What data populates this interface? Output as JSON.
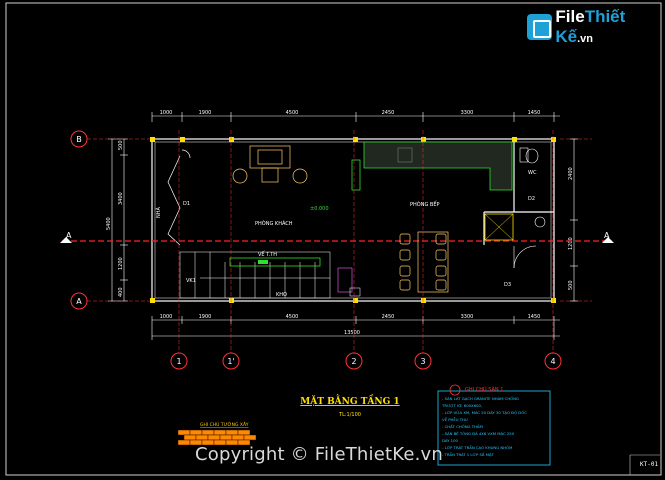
{
  "logo": {
    "brand_left": "File",
    "brand_right": "Thiết Kế",
    "suffix": ".vn"
  },
  "watermark": "Copyright © FileThietKe.vn",
  "sheet_no": "KT-01",
  "drawing": {
    "title": "MẶT BẰNG TẦNG 1",
    "scale": "TL:1/100",
    "dims_top": [
      "1000",
      "1900",
      "4500",
      "2450",
      "3300",
      "1450"
    ],
    "dims_bottom": [
      "1000",
      "1900",
      "4500",
      "2450",
      "3300",
      "1450"
    ],
    "total_bottom": "13500",
    "dims_left": [
      "500",
      "3400",
      "1200",
      "400"
    ],
    "total_left": "5400",
    "dims_right": [
      "2400",
      "1200",
      "500"
    ],
    "axes_col": [
      "1",
      "1'",
      "2",
      "3",
      "4"
    ],
    "axes_row": [
      "B",
      "A"
    ],
    "section": "A",
    "rooms": {
      "living": "PHÒNG KHÁCH",
      "kitchen": "PHÒNG BẾP",
      "wc": "WC",
      "stair": "VK1",
      "sub": "KHO",
      "level": "±0.000",
      "d1": "D1",
      "d2": "D2",
      "d3": "D3",
      "wall": "NHÀ",
      "corridor": "VẾ T.TH"
    },
    "notes_title": "GHI CHÚ SÀN 1",
    "notes": [
      "- SÀN LÁT GẠCH GRANITE NHÁM CHỐNG",
      "TRƯỢT KT: 600X600,",
      "- LỚP VỮA XM, MÁC 50 DÀY 30 TẠO ĐỘ DỐC",
      "VỀ PHỄU THU",
      "- CHẤT CHỐNG THẤM",
      "- SÀN BÊ TÔNG ĐÁ 4X6 VXM MÁC 250",
      "DÀY 100",
      "- LỚP TRÁT TRẦN CAO KHUNG NHÔM",
      "- TRẦN TRÁT 1 LỚP SẮ MẬT"
    ],
    "legend_title": "GHI CHÚ TƯỜNG XÂY"
  }
}
